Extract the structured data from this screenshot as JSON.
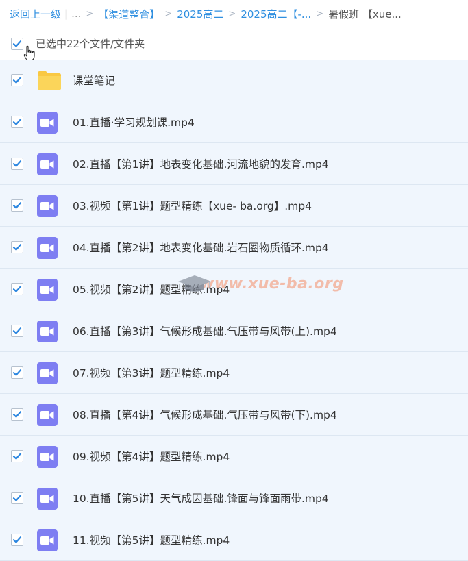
{
  "breadcrumb": {
    "back": "返回上一级",
    "divider": "|",
    "ellipsis": "...",
    "items": [
      "【渠道整合】",
      "2025高二",
      "2025高二【-..."
    ],
    "current": "暑假班 【xue..."
  },
  "selection": {
    "text": "已选中22个文件/文件夹",
    "checked": true
  },
  "watermark": {
    "text": "www.xue-ba.org"
  },
  "files": [
    {
      "name": "课堂笔记",
      "type": "folder"
    },
    {
      "name": "01.直播·学习规划课.mp4",
      "type": "video"
    },
    {
      "name": "02.直播【第1讲】地表变化基础.河流地貌的发育.mp4",
      "type": "video"
    },
    {
      "name": "03.视频【第1讲】题型精练【xue- ba.org】.mp4",
      "type": "video"
    },
    {
      "name": "04.直播【第2讲】地表变化基础.岩石圈物质循环.mp4",
      "type": "video"
    },
    {
      "name": "05.视频【第2讲】题型精练.mp4",
      "type": "video"
    },
    {
      "name": "06.直播【第3讲】气候形成基础.气压带与风带(上).mp4",
      "type": "video"
    },
    {
      "name": "07.视频【第3讲】题型精练.mp4",
      "type": "video"
    },
    {
      "name": "08.直播【第4讲】气候形成基础.气压带与风带(下).mp4",
      "type": "video"
    },
    {
      "name": "09.视频【第4讲】题型精练.mp4",
      "type": "video"
    },
    {
      "name": "10.直播【第5讲】天气成因基础.锋面与锋面雨带.mp4",
      "type": "video"
    },
    {
      "name": "11.视频【第5讲】题型精练.mp4",
      "type": "video"
    }
  ],
  "colors": {
    "link": "#2f8fe0",
    "checkbox": "#2b86e0",
    "row_bg": "#f0f6fd",
    "video_icon": "#7e7ef2",
    "folder": "#f9c843"
  }
}
